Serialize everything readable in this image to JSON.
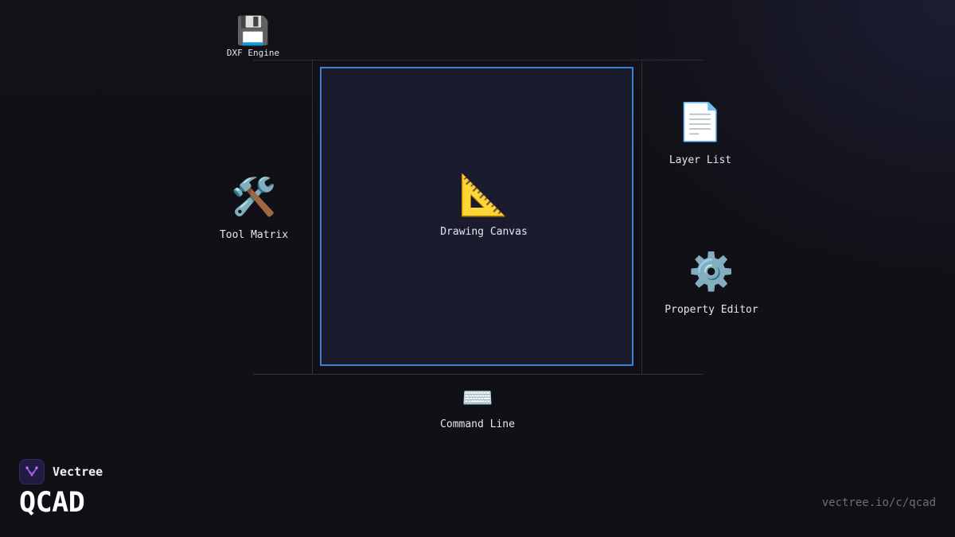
{
  "nodes": {
    "dxf_engine": {
      "label": "DXF Engine",
      "icon": "floppy-disk-icon",
      "glyph": "💾"
    },
    "tool_matrix": {
      "label": "Tool Matrix",
      "icon": "hammer-and-wrench-icon",
      "glyph": "🛠️"
    },
    "drawing_canvas": {
      "label": "Drawing Canvas",
      "icon": "triangular-ruler-icon",
      "glyph": "📐"
    },
    "layer_list": {
      "label": "Layer List",
      "icon": "document-icon",
      "glyph": "📄"
    },
    "property_editor": {
      "label": "Property Editor",
      "icon": "gear-icon",
      "glyph": "⚙️"
    },
    "command_line": {
      "label": "Command Line",
      "icon": "keyboard-icon",
      "glyph": "⌨️"
    }
  },
  "brand": {
    "name": "Vectree",
    "logo_icon": "vectree-logo-icon"
  },
  "app_title": "QCAD",
  "footer_url": "vectree.io/c/qcad",
  "colors": {
    "background": "#111117",
    "canvas_fill": "#1a1b2e",
    "canvas_border": "#3f7fcf",
    "grid_lines": "#2e3240",
    "url_text": "#6d6e78",
    "logo_accent": "#b04fd6"
  }
}
